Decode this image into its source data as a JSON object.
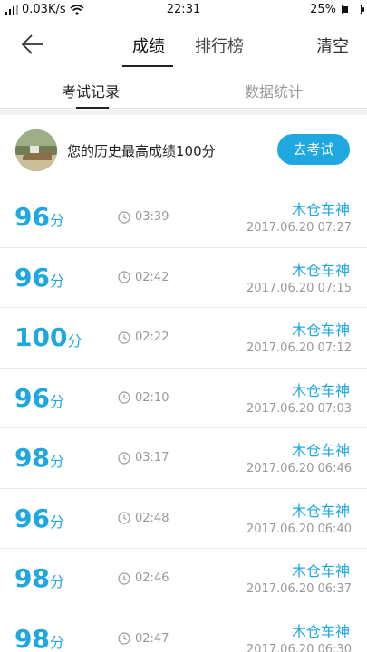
{
  "status_bar": {
    "network_speed": "0.03K/s",
    "time": "22:31",
    "battery": "25%",
    "battery_level": 0.25
  },
  "nav": {
    "tab_scores": "成绩",
    "tab_rank": "排行榜",
    "clear": "清空"
  },
  "subtabs": {
    "records": "考试记录",
    "stats": "数据统计"
  },
  "best": {
    "text": "您的历史最高成绩100分",
    "button": "去考试"
  },
  "unit": "分",
  "records": [
    {
      "score": "96",
      "duration": "03:39",
      "user": "木仓车神",
      "date": "2017.06.20  07:27"
    },
    {
      "score": "96",
      "duration": "02:42",
      "user": "木仓车神",
      "date": "2017.06.20  07:15"
    },
    {
      "score": "100",
      "duration": "02:22",
      "user": "木仓车神",
      "date": "2017.06.20  07:12"
    },
    {
      "score": "96",
      "duration": "02:10",
      "user": "木仓车神",
      "date": "2017.06.20  07:03"
    },
    {
      "score": "98",
      "duration": "03:17",
      "user": "木仓车神",
      "date": "2017.06.20  06:46"
    },
    {
      "score": "96",
      "duration": "02:48",
      "user": "木仓车神",
      "date": "2017.06.20  06:40"
    },
    {
      "score": "98",
      "duration": "02:46",
      "user": "木仓车神",
      "date": "2017.06.20  06:37"
    },
    {
      "score": "98",
      "duration": "02:47",
      "user": "木仓车神",
      "date": "2017.06.20  06:30"
    }
  ],
  "colors": {
    "accent": "#1fa8e0",
    "muted": "#999999"
  }
}
